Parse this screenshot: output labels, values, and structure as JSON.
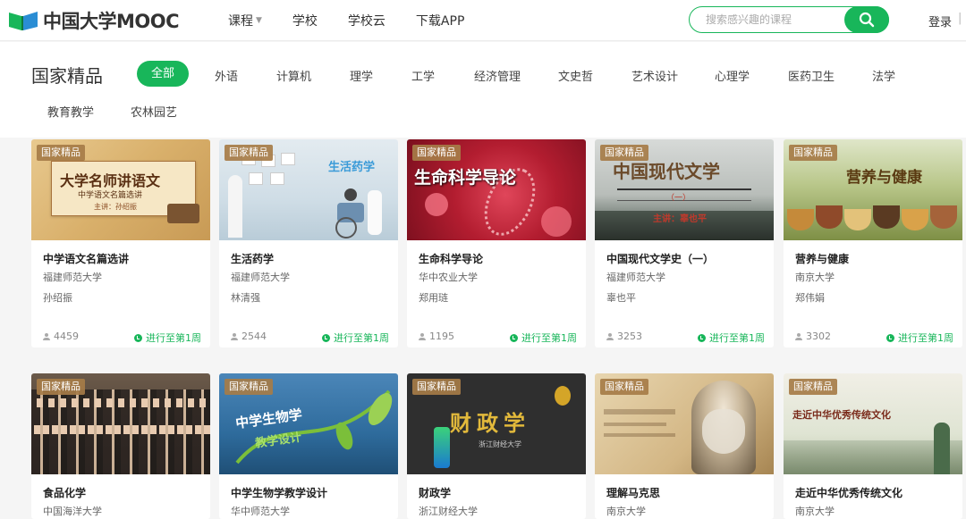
{
  "header": {
    "logo_text": "中国大学MOOC",
    "nav": [
      "课程",
      "学校",
      "学校云",
      "下载APP"
    ],
    "search_placeholder": "搜索感兴趣的课程",
    "login": "登录",
    "login_sep": "|"
  },
  "page_title": "国家精品",
  "categories": [
    "全部",
    "外语",
    "计算机",
    "理学",
    "工学",
    "经济管理",
    "文史哲",
    "艺术设计",
    "心理学",
    "医药卫生",
    "法学",
    "教育教学",
    "农林园艺"
  ],
  "active_category": "全部",
  "badge_label": "国家精品",
  "courses": [
    {
      "title": "中学语文名篇选讲",
      "school": "福建师范大学",
      "teacher": "孙绍振",
      "enrolled": "4459",
      "progress": "进行至第1周",
      "thumb": {
        "text": "大学名师讲语文",
        "sub": "中学语文名篇选讲",
        "sub2": "主讲：孙绍振"
      }
    },
    {
      "title": "生活药学",
      "school": "福建师范大学",
      "teacher": "林清强",
      "enrolled": "2544",
      "progress": "进行至第1周",
      "thumb": {
        "text": "生活药学"
      }
    },
    {
      "title": "生命科学导论",
      "school": "华中农业大学",
      "teacher": "郑用琏",
      "enrolled": "1195",
      "progress": "进行至第1周",
      "thumb": {
        "text": "生命科学导论"
      }
    },
    {
      "title": "中国现代文学史（一）",
      "school": "福建师范大学",
      "teacher": "辜也平",
      "enrolled": "3253",
      "progress": "进行至第1周",
      "thumb": {
        "text": "中国现代文学",
        "sub": "（一）",
        "sub2": "主讲：辜也平"
      }
    },
    {
      "title": "营养与健康",
      "school": "南京大学",
      "teacher": "郑伟娟",
      "enrolled": "3302",
      "progress": "进行至第1周",
      "thumb": {
        "text": "营养与健康"
      }
    },
    {
      "title": "食品化学",
      "school": "中国海洋大学",
      "teacher": "",
      "enrolled": "",
      "progress": "",
      "thumb": {}
    },
    {
      "title": "中学生物学教学设计",
      "school": "华中师范大学",
      "teacher": "",
      "enrolled": "",
      "progress": "",
      "thumb": {
        "text": "中学生物学",
        "sub": "教学设计"
      }
    },
    {
      "title": "财政学",
      "school": "浙江财经大学",
      "teacher": "",
      "enrolled": "",
      "progress": "",
      "thumb": {
        "text": "财政学",
        "sub": "浙江财经大学"
      }
    },
    {
      "title": "理解马克思",
      "school": "南京大学",
      "teacher": "",
      "enrolled": "",
      "progress": "",
      "thumb": {}
    },
    {
      "title": "走近中华优秀传统文化",
      "school": "南京大学",
      "teacher": "",
      "enrolled": "",
      "progress": "",
      "thumb": {
        "text": "走近中华优秀传统文化"
      }
    }
  ],
  "colors": {
    "accent": "#18b65a",
    "badge": "#a67c48"
  }
}
